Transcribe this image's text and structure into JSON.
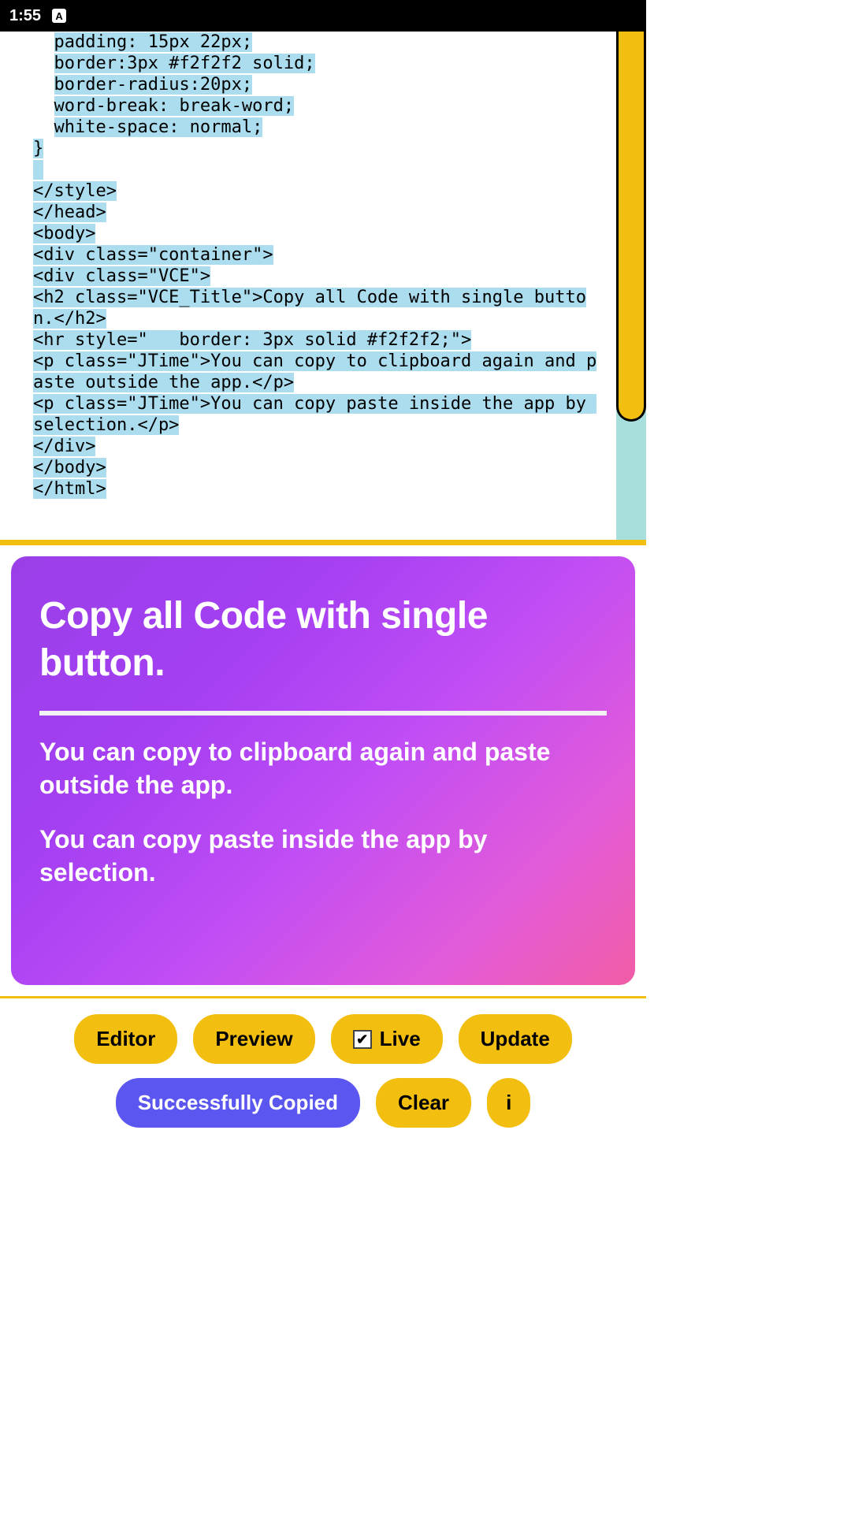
{
  "status": {
    "time": "1:55",
    "icon_glyph": "A"
  },
  "code": {
    "lines_indented": [
      "padding: 15px 22px;",
      "border:3px #f2f2f2 solid;",
      "border-radius:20px;",
      "word-break: break-word;",
      "white-space: normal;"
    ],
    "close_brace": "}",
    "blocks": [
      "</style>",
      "</head>",
      "<body>",
      "<div class=\"container\">",
      "<div class=\"VCE\">",
      "<h2 class=\"VCE_Title\">Copy all Code with single button.</h2>",
      "<hr style=\"   border: 3px solid #f2f2f2;\">",
      "<p class=\"JTime\">You can copy to clipboard again and paste outside the app.</p>",
      "<p class=\"JTime\">You can copy paste inside the app by selection.</p>",
      "</div>",
      "</body>",
      "</html>"
    ]
  },
  "preview": {
    "title": "Copy all Code with single button.",
    "p1": "You can copy to clipboard again and paste outside the app.",
    "p2": "You can copy paste inside the app by selection."
  },
  "toolbar": {
    "editor": "Editor",
    "preview": "Preview",
    "live": "Live",
    "live_checked": true,
    "update": "Update",
    "status": "Successfully Copied",
    "clear": "Clear",
    "info": "i"
  }
}
